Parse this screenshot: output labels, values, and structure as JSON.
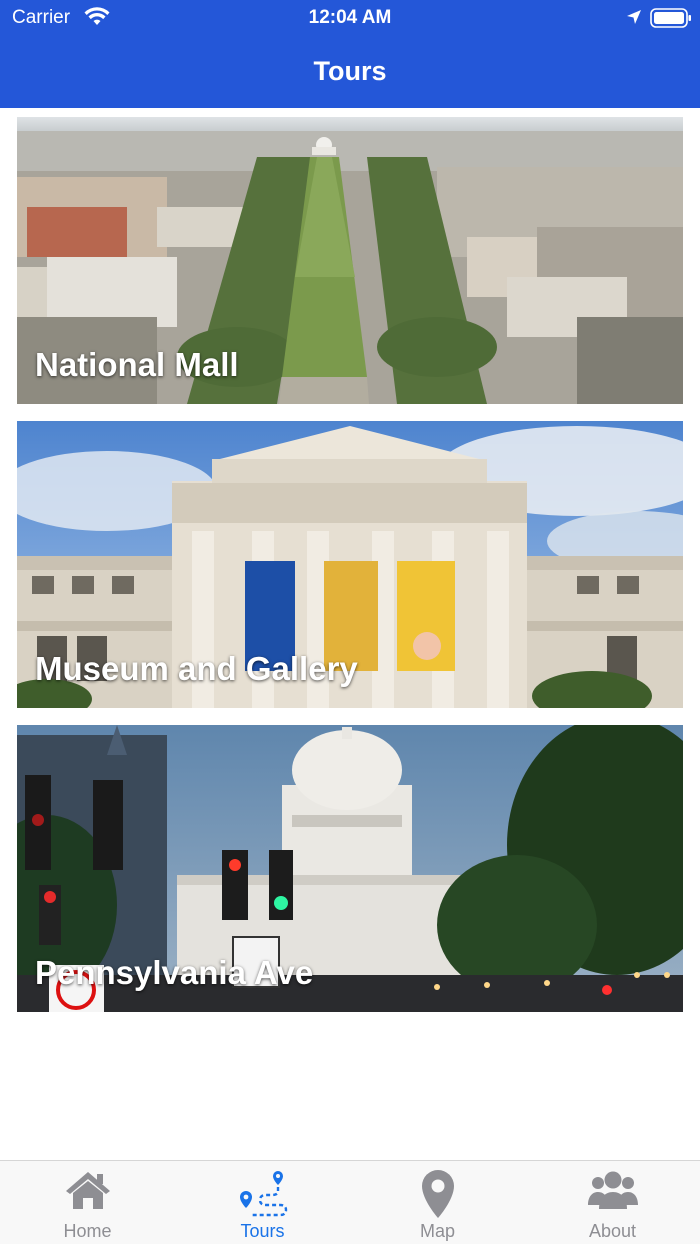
{
  "status_bar": {
    "carrier": "Carrier",
    "time": "12:04 AM"
  },
  "nav": {
    "title": "Tours"
  },
  "tours": [
    {
      "name": "National Mall"
    },
    {
      "name": "Museum and Gallery"
    },
    {
      "name": "Pennsylvania Ave"
    }
  ],
  "tab_bar": {
    "items": [
      {
        "label": "Home",
        "icon": "home-icon",
        "active": false
      },
      {
        "label": "Tours",
        "icon": "tours-route-icon",
        "active": true
      },
      {
        "label": "Map",
        "icon": "map-pin-icon",
        "active": false
      },
      {
        "label": "About",
        "icon": "users-icon",
        "active": false
      }
    ]
  },
  "colors": {
    "header": "#2457d8",
    "tab_active": "#1a73e8",
    "tab_inactive": "#8e8e93"
  }
}
